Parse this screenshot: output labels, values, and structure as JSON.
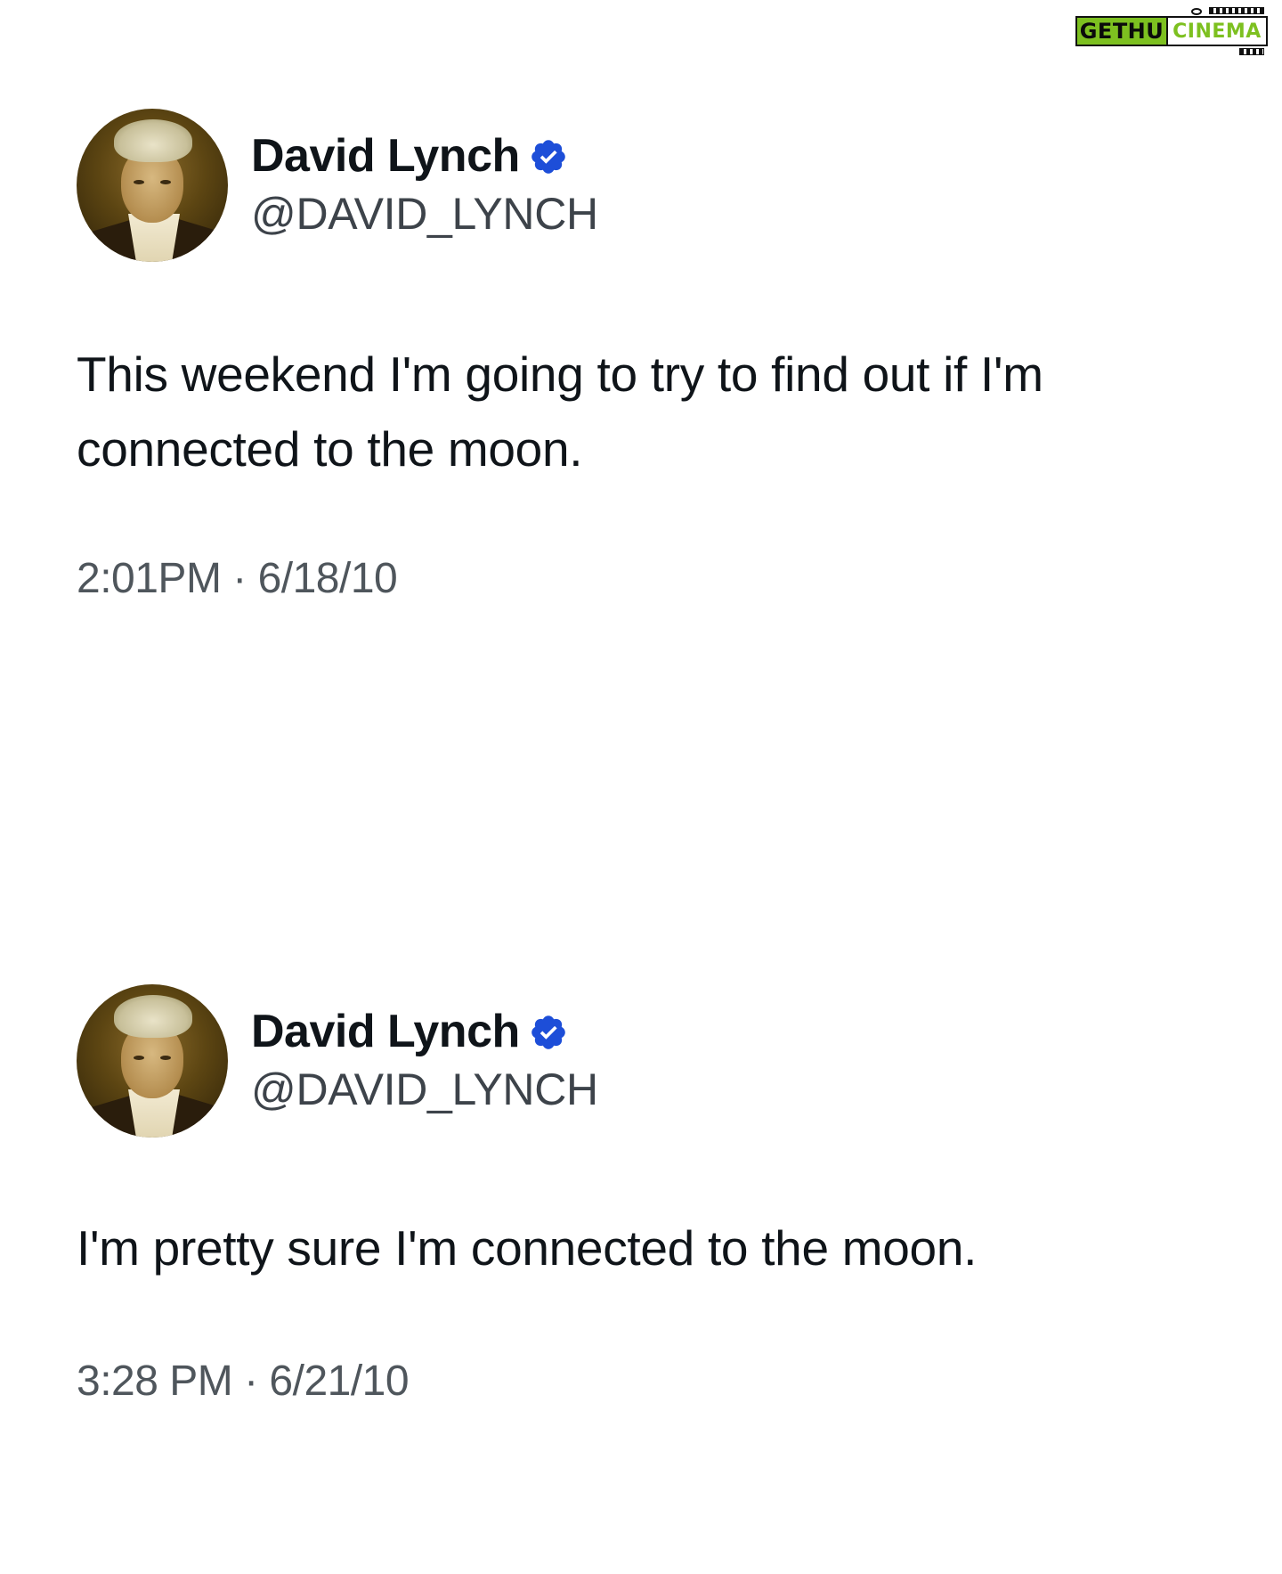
{
  "watermark": {
    "left_text": "GETHU",
    "right_text": "CINEMA",
    "accent_color": "#7dc020"
  },
  "tweets": [
    {
      "author": {
        "display_name": "David Lynch",
        "handle": "@DAVID_LYNCH",
        "verified": true,
        "verified_icon": "verified-badge-icon",
        "avatar": "profile-photo"
      },
      "text": "This weekend I'm going to try to find out if I'm connected to the moon.",
      "timestamp": "2:01PM · 6/18/10"
    },
    {
      "author": {
        "display_name": "David Lynch",
        "handle": "@DAVID_LYNCH",
        "verified": true,
        "verified_icon": "verified-badge-icon",
        "avatar": "profile-photo"
      },
      "text": "I'm pretty sure I'm connected to the moon.",
      "timestamp": "3:28 PM · 6/21/10"
    }
  ],
  "colors": {
    "text_primary": "#0f1419",
    "text_secondary": "#4f565c",
    "verified_badge": "#1d4ed8"
  }
}
